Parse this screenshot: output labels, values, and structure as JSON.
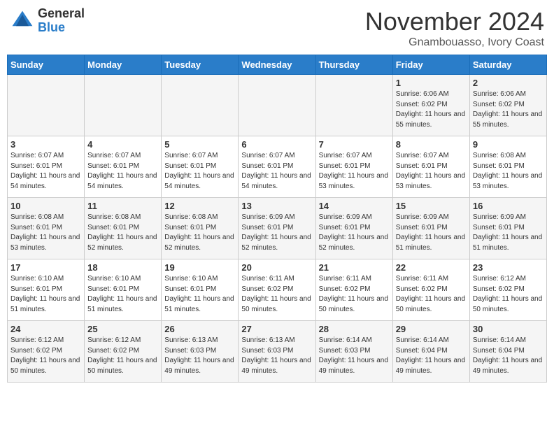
{
  "header": {
    "logo_general": "General",
    "logo_blue": "Blue",
    "month_title": "November 2024",
    "location": "Gnambouasso, Ivory Coast"
  },
  "weekdays": [
    "Sunday",
    "Monday",
    "Tuesday",
    "Wednesday",
    "Thursday",
    "Friday",
    "Saturday"
  ],
  "weeks": [
    [
      {
        "day": "",
        "info": ""
      },
      {
        "day": "",
        "info": ""
      },
      {
        "day": "",
        "info": ""
      },
      {
        "day": "",
        "info": ""
      },
      {
        "day": "",
        "info": ""
      },
      {
        "day": "1",
        "info": "Sunrise: 6:06 AM\nSunset: 6:02 PM\nDaylight: 11 hours and 55 minutes."
      },
      {
        "day": "2",
        "info": "Sunrise: 6:06 AM\nSunset: 6:02 PM\nDaylight: 11 hours and 55 minutes."
      }
    ],
    [
      {
        "day": "3",
        "info": "Sunrise: 6:07 AM\nSunset: 6:01 PM\nDaylight: 11 hours and 54 minutes."
      },
      {
        "day": "4",
        "info": "Sunrise: 6:07 AM\nSunset: 6:01 PM\nDaylight: 11 hours and 54 minutes."
      },
      {
        "day": "5",
        "info": "Sunrise: 6:07 AM\nSunset: 6:01 PM\nDaylight: 11 hours and 54 minutes."
      },
      {
        "day": "6",
        "info": "Sunrise: 6:07 AM\nSunset: 6:01 PM\nDaylight: 11 hours and 54 minutes."
      },
      {
        "day": "7",
        "info": "Sunrise: 6:07 AM\nSunset: 6:01 PM\nDaylight: 11 hours and 53 minutes."
      },
      {
        "day": "8",
        "info": "Sunrise: 6:07 AM\nSunset: 6:01 PM\nDaylight: 11 hours and 53 minutes."
      },
      {
        "day": "9",
        "info": "Sunrise: 6:08 AM\nSunset: 6:01 PM\nDaylight: 11 hours and 53 minutes."
      }
    ],
    [
      {
        "day": "10",
        "info": "Sunrise: 6:08 AM\nSunset: 6:01 PM\nDaylight: 11 hours and 53 minutes."
      },
      {
        "day": "11",
        "info": "Sunrise: 6:08 AM\nSunset: 6:01 PM\nDaylight: 11 hours and 52 minutes."
      },
      {
        "day": "12",
        "info": "Sunrise: 6:08 AM\nSunset: 6:01 PM\nDaylight: 11 hours and 52 minutes."
      },
      {
        "day": "13",
        "info": "Sunrise: 6:09 AM\nSunset: 6:01 PM\nDaylight: 11 hours and 52 minutes."
      },
      {
        "day": "14",
        "info": "Sunrise: 6:09 AM\nSunset: 6:01 PM\nDaylight: 11 hours and 52 minutes."
      },
      {
        "day": "15",
        "info": "Sunrise: 6:09 AM\nSunset: 6:01 PM\nDaylight: 11 hours and 51 minutes."
      },
      {
        "day": "16",
        "info": "Sunrise: 6:09 AM\nSunset: 6:01 PM\nDaylight: 11 hours and 51 minutes."
      }
    ],
    [
      {
        "day": "17",
        "info": "Sunrise: 6:10 AM\nSunset: 6:01 PM\nDaylight: 11 hours and 51 minutes."
      },
      {
        "day": "18",
        "info": "Sunrise: 6:10 AM\nSunset: 6:01 PM\nDaylight: 11 hours and 51 minutes."
      },
      {
        "day": "19",
        "info": "Sunrise: 6:10 AM\nSunset: 6:01 PM\nDaylight: 11 hours and 51 minutes."
      },
      {
        "day": "20",
        "info": "Sunrise: 6:11 AM\nSunset: 6:02 PM\nDaylight: 11 hours and 50 minutes."
      },
      {
        "day": "21",
        "info": "Sunrise: 6:11 AM\nSunset: 6:02 PM\nDaylight: 11 hours and 50 minutes."
      },
      {
        "day": "22",
        "info": "Sunrise: 6:11 AM\nSunset: 6:02 PM\nDaylight: 11 hours and 50 minutes."
      },
      {
        "day": "23",
        "info": "Sunrise: 6:12 AM\nSunset: 6:02 PM\nDaylight: 11 hours and 50 minutes."
      }
    ],
    [
      {
        "day": "24",
        "info": "Sunrise: 6:12 AM\nSunset: 6:02 PM\nDaylight: 11 hours and 50 minutes."
      },
      {
        "day": "25",
        "info": "Sunrise: 6:12 AM\nSunset: 6:02 PM\nDaylight: 11 hours and 50 minutes."
      },
      {
        "day": "26",
        "info": "Sunrise: 6:13 AM\nSunset: 6:03 PM\nDaylight: 11 hours and 49 minutes."
      },
      {
        "day": "27",
        "info": "Sunrise: 6:13 AM\nSunset: 6:03 PM\nDaylight: 11 hours and 49 minutes."
      },
      {
        "day": "28",
        "info": "Sunrise: 6:14 AM\nSunset: 6:03 PM\nDaylight: 11 hours and 49 minutes."
      },
      {
        "day": "29",
        "info": "Sunrise: 6:14 AM\nSunset: 6:04 PM\nDaylight: 11 hours and 49 minutes."
      },
      {
        "day": "30",
        "info": "Sunrise: 6:14 AM\nSunset: 6:04 PM\nDaylight: 11 hours and 49 minutes."
      }
    ]
  ]
}
